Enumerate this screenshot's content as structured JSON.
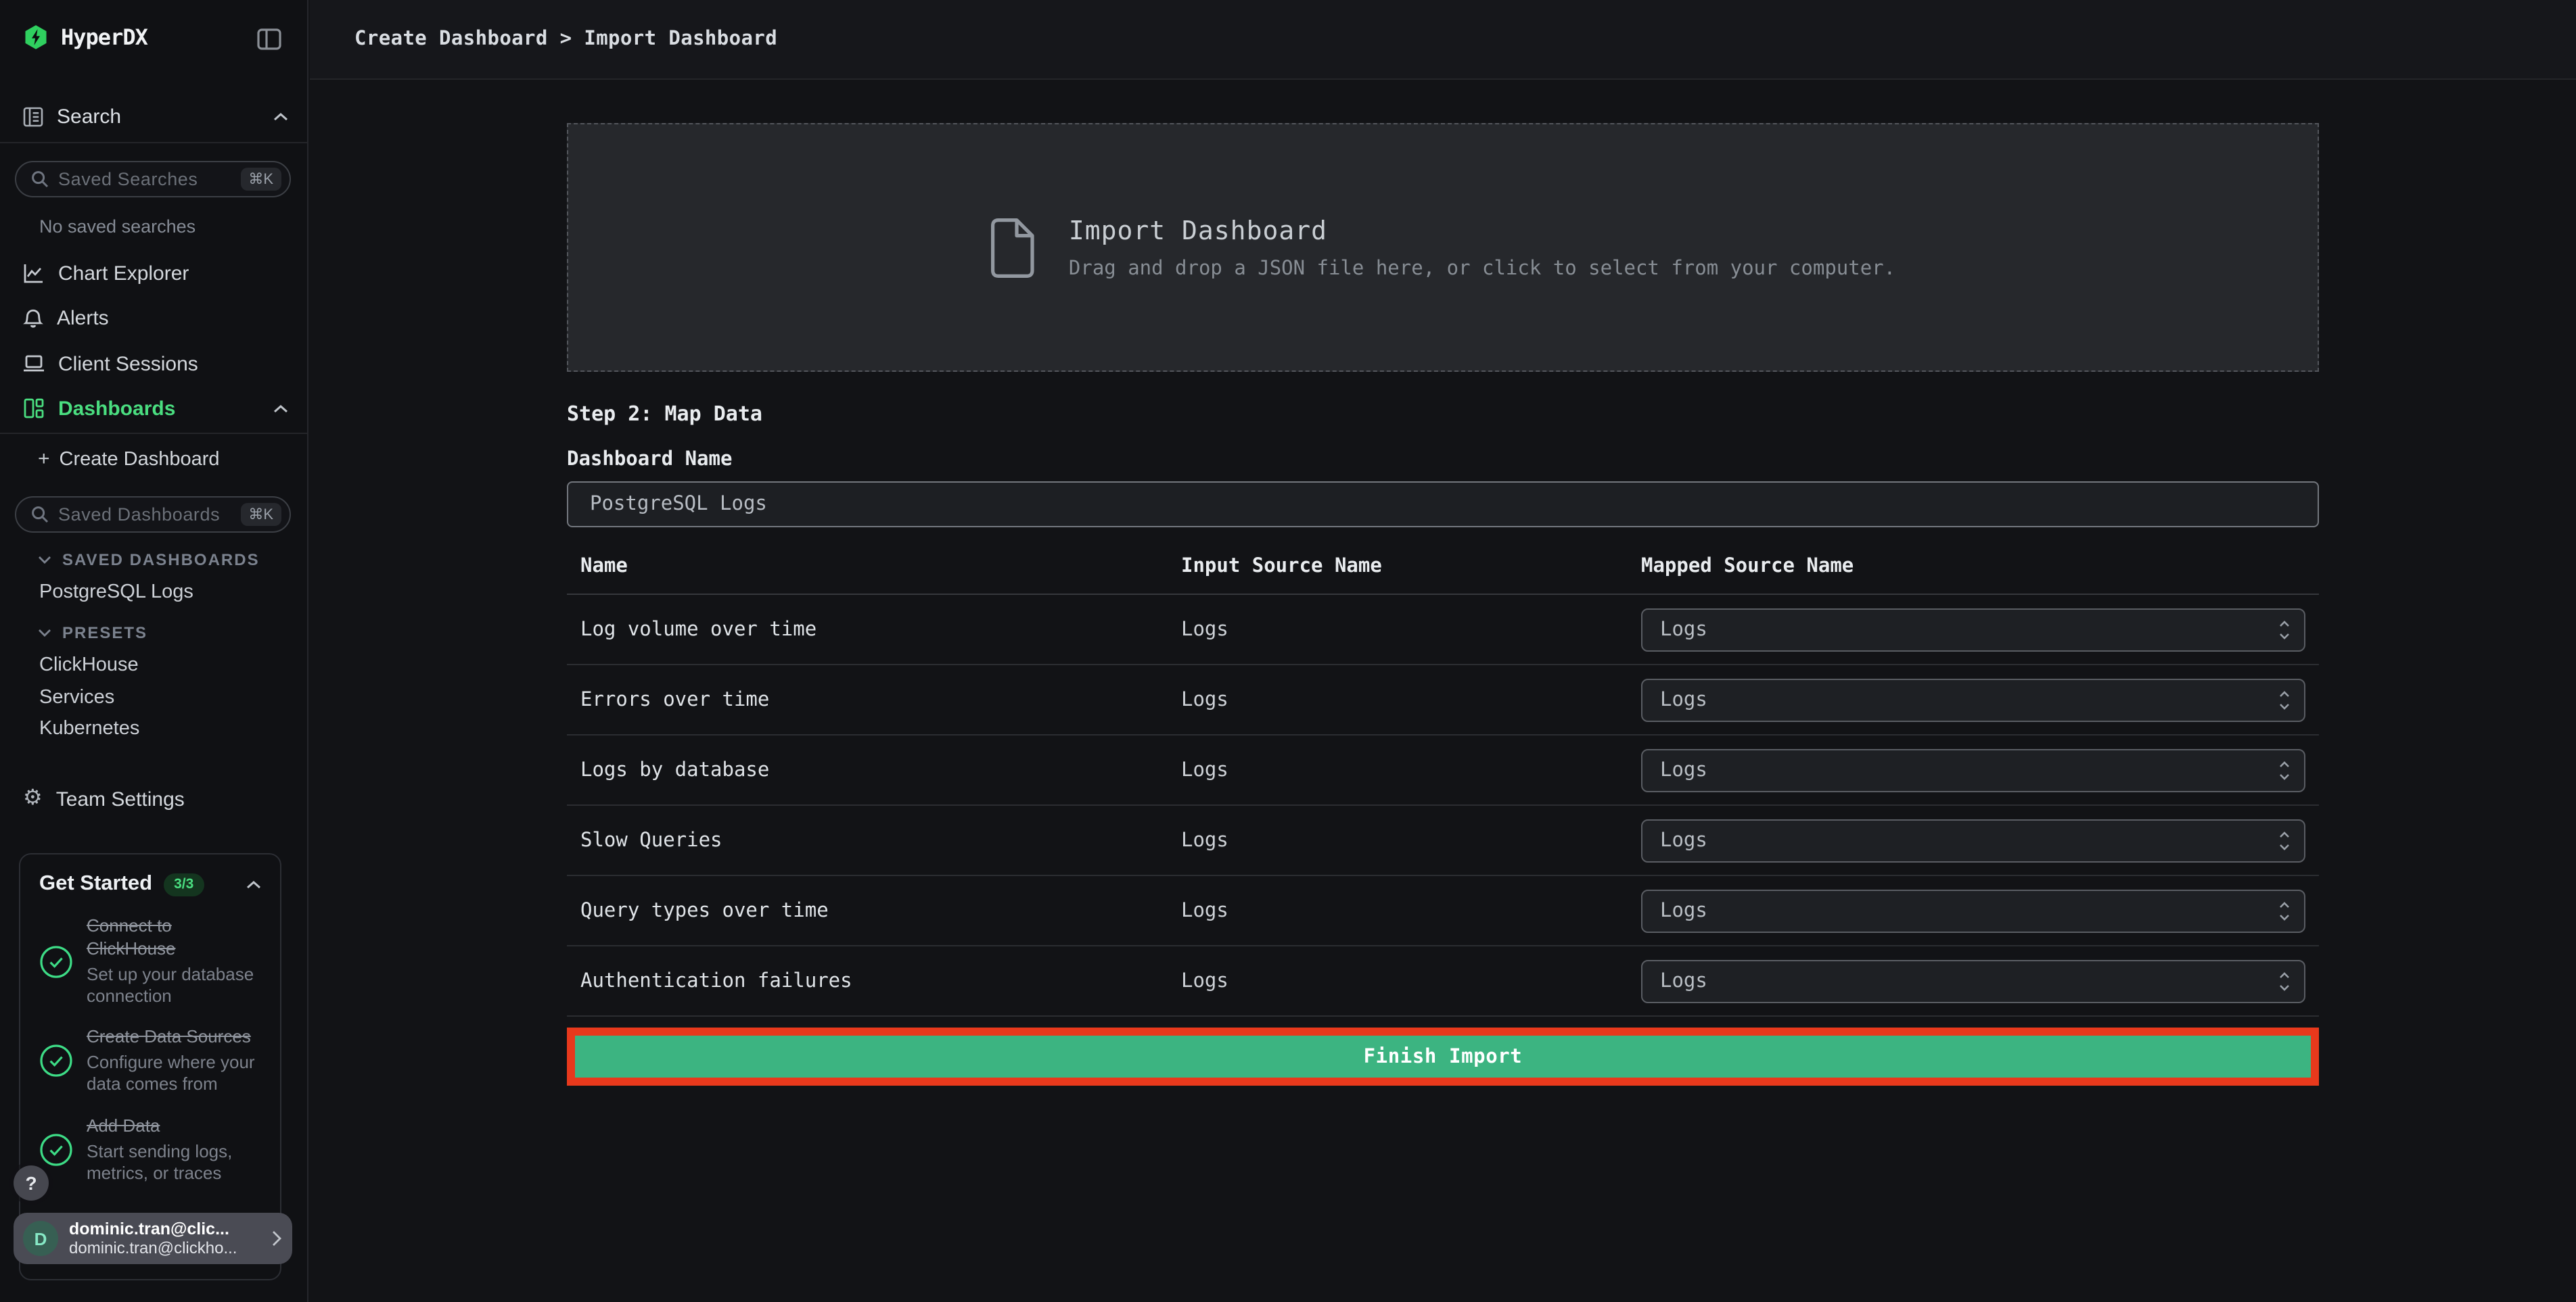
{
  "app": {
    "name": "HyperDX"
  },
  "topbar": {
    "breadcrumb": "Create Dashboard > Import Dashboard"
  },
  "sidebar": {
    "search_section_label": "Search",
    "saved_searches": {
      "placeholder": "Saved Searches",
      "shortcut": "⌘K"
    },
    "no_saved_searches": "No saved searches",
    "nav": [
      {
        "label": "Chart Explorer"
      },
      {
        "label": "Alerts"
      },
      {
        "label": "Client Sessions"
      },
      {
        "label": "Dashboards"
      }
    ],
    "create_dashboard_label": "Create Dashboard",
    "create_dashboard_plus": "+",
    "saved_dashboards_search": {
      "placeholder": "Saved Dashboards",
      "shortcut": "⌘K"
    },
    "saved_dashboards_header": "SAVED DASHBOARDS",
    "saved_dashboards": [
      {
        "label": "PostgreSQL Logs"
      }
    ],
    "presets_header": "PRESETS",
    "presets": [
      {
        "label": "ClickHouse"
      },
      {
        "label": "Services"
      },
      {
        "label": "Kubernetes"
      }
    ],
    "team_settings_label": "Team Settings",
    "gear_glyph": "⚙"
  },
  "get_started": {
    "title": "Get Started",
    "badge": "3/3",
    "items": [
      {
        "title": "Connect to ClickHouse",
        "description": "Set up your database connection"
      },
      {
        "title": "Create Data Sources",
        "description": "Configure where your data comes from"
      },
      {
        "title": "Add Data",
        "description": "Start sending logs, metrics, or traces"
      }
    ]
  },
  "user": {
    "help_label": "?",
    "avatar_initial": "D",
    "name": "dominic.tran@clic...",
    "email": "dominic.tran@clickho..."
  },
  "import": {
    "dropzone": {
      "title": "Import Dashboard",
      "subtitle": "Drag and drop a JSON file here, or click to select from your computer."
    },
    "step_label": "Step 2: Map Data",
    "dashboard_name_label": "Dashboard Name",
    "dashboard_name_value": "PostgreSQL Logs",
    "table": {
      "columns": [
        "Name",
        "Input Source Name",
        "Mapped Source Name"
      ],
      "rows": [
        {
          "name": "Log volume over time",
          "input_source": "Logs",
          "mapped_source": "Logs"
        },
        {
          "name": "Errors over time",
          "input_source": "Logs",
          "mapped_source": "Logs"
        },
        {
          "name": "Logs by database",
          "input_source": "Logs",
          "mapped_source": "Logs"
        },
        {
          "name": "Slow Queries",
          "input_source": "Logs",
          "mapped_source": "Logs"
        },
        {
          "name": "Query types over time",
          "input_source": "Logs",
          "mapped_source": "Logs"
        },
        {
          "name": "Authentication failures",
          "input_source": "Logs",
          "mapped_source": "Logs"
        }
      ]
    },
    "finish_button_label": "Finish Import"
  },
  "colors": {
    "accent_green": "#4ade80",
    "button_green": "#3cb481",
    "annotation_red": "#e8391c",
    "logo_green": "#2fd05f",
    "background": "#121316"
  }
}
